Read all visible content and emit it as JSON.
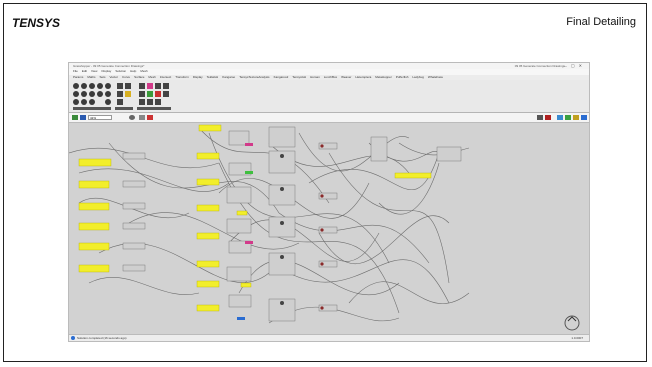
{
  "slide": {
    "brand": "TENSYS",
    "section_title": "Final Detailing"
  },
  "app": {
    "name": "Grasshopper",
    "window_title": "Grasshopper - 09 05 Generate Connection Drawings*",
    "document_title": "09 05 Generate Connection Drawings",
    "menu": [
      "File",
      "Edit",
      "View",
      "Display",
      "Solution",
      "Help",
      "Mesh"
    ],
    "tabs": [
      "Params",
      "Maths",
      "Sets",
      "Vector",
      "Curve",
      "Surface",
      "Mesh",
      "Intersect",
      "Transform",
      "Display",
      "TeklaGH",
      "Kangaroo",
      "TensysTextureAnalysis",
      "Kangaroo2",
      "TensysGH",
      "Human",
      "LunchBox",
      "Weaver",
      "Heteroptera",
      "MetaHopper",
      "Pufferfish",
      "Ladybug",
      "WhaleFace"
    ],
    "canvas_zoom": "41%",
    "status_text": "Solution completed (16 seconds ago)",
    "version": "1.0.0007",
    "accent_colors": {
      "panel_yellow": "#f2ee2b",
      "component_grey": "#cfcfcf",
      "canvas_bg": "#d2d2d2",
      "status_blue": "#2a6cd1"
    }
  }
}
